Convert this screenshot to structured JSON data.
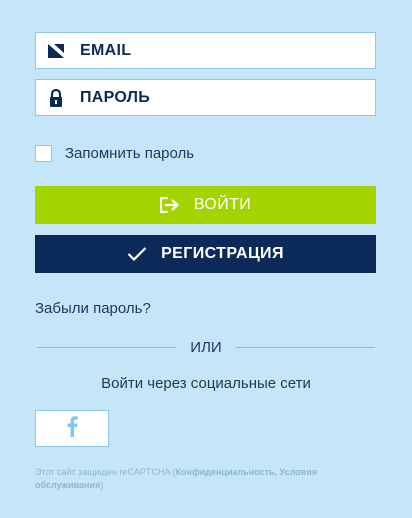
{
  "form": {
    "email_placeholder": "EMAIL",
    "password_placeholder": "ПАРОЛЬ",
    "remember_label": "Запомнить пароль",
    "login_label": "ВОЙТИ",
    "register_label": "РЕГИСТРАЦИЯ",
    "forgot_label": "Забыли пароль?",
    "or_label": "ИЛИ",
    "social_title": "Войти через социальные сети"
  },
  "icons": {
    "email": "envelope-icon",
    "password": "lock-icon",
    "login": "sign-in-icon",
    "register": "check-icon",
    "facebook": "facebook-icon"
  },
  "recaptcha": {
    "prefix": "Этот сайт защищен reCAPTCHA (",
    "privacy": "Конфиденциальность",
    "sep": ", ",
    "terms": "Условия обслуживания",
    "suffix": ")"
  },
  "colors": {
    "background": "#c5e6f8",
    "login_button": "#a4d400",
    "register_button": "#0b2a5a",
    "text": "#1d3a60",
    "facebook": "#7ec8ee"
  }
}
